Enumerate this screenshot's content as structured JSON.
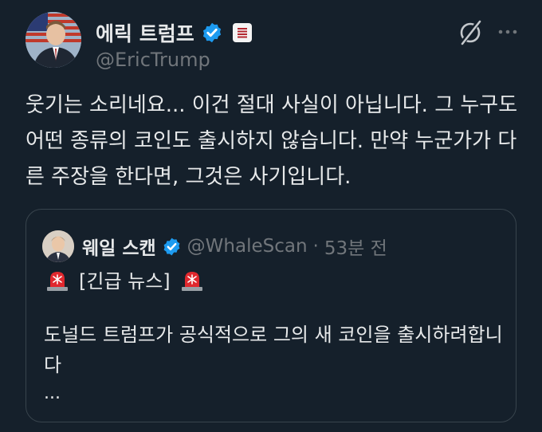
{
  "author": {
    "name": "에릭 트럼프",
    "handle": "@EricTrump"
  },
  "tweet": {
    "text": "웃기는 소리네요... 이건 절대 사실이 아닙니다. 그 누구도 어떤 종류의 코인도 출시하지 않습니다. 만약 누군가가 다른 주장을 한다면, 그것은 사기입니다."
  },
  "quote": {
    "name": "웨일 스캔",
    "handle": "@WhaleScan",
    "separator": "·",
    "time": "53분 전",
    "headline": "[긴급 뉴스]",
    "body": "도널드 트럼프가 공식적으로 그의 새 코인을 출시하려합니다",
    "ellipsis": "..."
  },
  "colors": {
    "background": "#15202b",
    "text": "#e7e9ea",
    "muted": "#71767b",
    "verified": "#1d9bf0",
    "border": "#38444d",
    "siren": "#e0282e"
  },
  "icons": {
    "verified": "verified-badge-icon",
    "label": "government-label-icon",
    "grok": "grok-icon",
    "more": "more-icon",
    "siren": "siren-emoji-icon"
  }
}
